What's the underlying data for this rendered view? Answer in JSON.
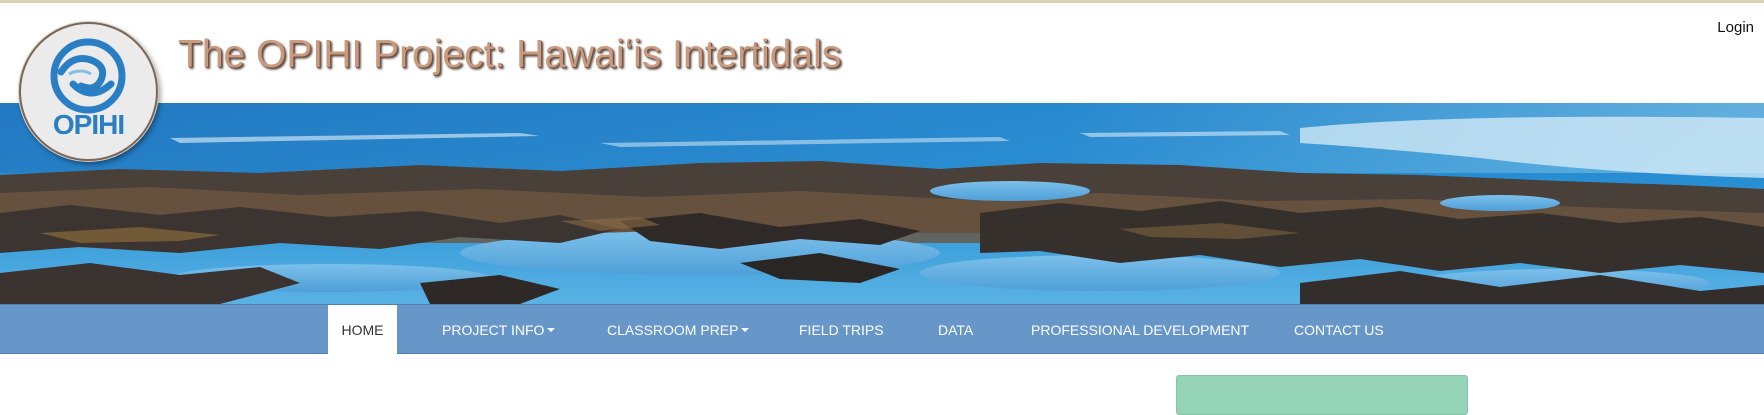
{
  "site": {
    "title": "The OPIHI Project: Hawaiʻis Intertidals",
    "logo_text": "OPIHI",
    "login_label": "Login"
  },
  "banner": {
    "description": "Intertidal rocky shoreline with tide pools and blue ocean",
    "colors": {
      "sky": "#e8f2f8",
      "ocean": "#2e8fd0",
      "rock": "#3a3430",
      "pool": "#6fb6e6"
    }
  },
  "nav": {
    "items": [
      {
        "label": "HOME",
        "active": true,
        "dropdown": false
      },
      {
        "label": "PROJECT INFO",
        "active": false,
        "dropdown": true
      },
      {
        "label": "CLASSROOM PREP",
        "active": false,
        "dropdown": true
      },
      {
        "label": "FIELD TRIPS",
        "active": false,
        "dropdown": false
      },
      {
        "label": "DATA",
        "active": false,
        "dropdown": false
      },
      {
        "label": "PROFESSIONAL DEVELOPMENT",
        "active": false,
        "dropdown": false
      },
      {
        "label": "CONTACT US",
        "active": false,
        "dropdown": false
      }
    ],
    "bar_color": "#6796c9"
  },
  "colors": {
    "title_text": "#c99a7d",
    "side_box": "#95d3b8",
    "logo_blue": "#2a7fc4"
  }
}
